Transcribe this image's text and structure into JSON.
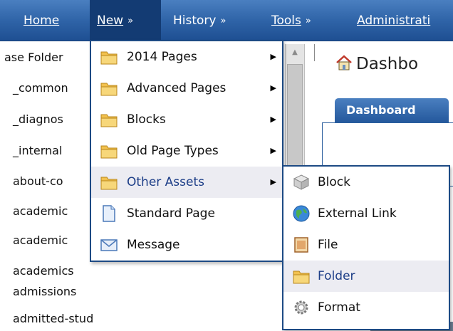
{
  "nav": {
    "home": "Home",
    "new": "New",
    "history": "History",
    "tools": "Tools",
    "administration": "Administrati"
  },
  "tree": {
    "items": [
      "ase Folder",
      "_common",
      "_diagnos",
      "_internal",
      "about-co",
      "academic",
      "academic",
      "academics",
      "admissions",
      "admitted-students"
    ]
  },
  "new_menu": {
    "items": [
      {
        "label": "2014 Pages",
        "icon": "folder-icon",
        "has_submenu": true
      },
      {
        "label": "Advanced Pages",
        "icon": "folder-icon",
        "has_submenu": true
      },
      {
        "label": "Blocks",
        "icon": "folder-icon",
        "has_submenu": true
      },
      {
        "label": "Old Page Types",
        "icon": "folder-icon",
        "has_submenu": true
      },
      {
        "label": "Other Assets",
        "icon": "folder-icon",
        "has_submenu": true,
        "highlighted": true
      },
      {
        "label": "Standard Page",
        "icon": "page-icon",
        "has_submenu": false
      },
      {
        "label": "Message",
        "icon": "envelope-icon",
        "has_submenu": false
      }
    ]
  },
  "other_assets_menu": {
    "items": [
      {
        "label": "Block",
        "icon": "cube-icon"
      },
      {
        "label": "External Link",
        "icon": "globe-icon"
      },
      {
        "label": "File",
        "icon": "file-icon"
      },
      {
        "label": "Folder",
        "icon": "folder-icon",
        "highlighted": true
      },
      {
        "label": "Format",
        "icon": "gear-icon"
      }
    ]
  },
  "dashboard": {
    "title": "Dashbo",
    "tab": "Dashboard"
  },
  "colors": {
    "nav_bar": "#2f64a8",
    "nav_active": "#133b73",
    "menu_border": "#1d4a84",
    "highlight": "#ececf2",
    "folder": "#f2c14e"
  }
}
